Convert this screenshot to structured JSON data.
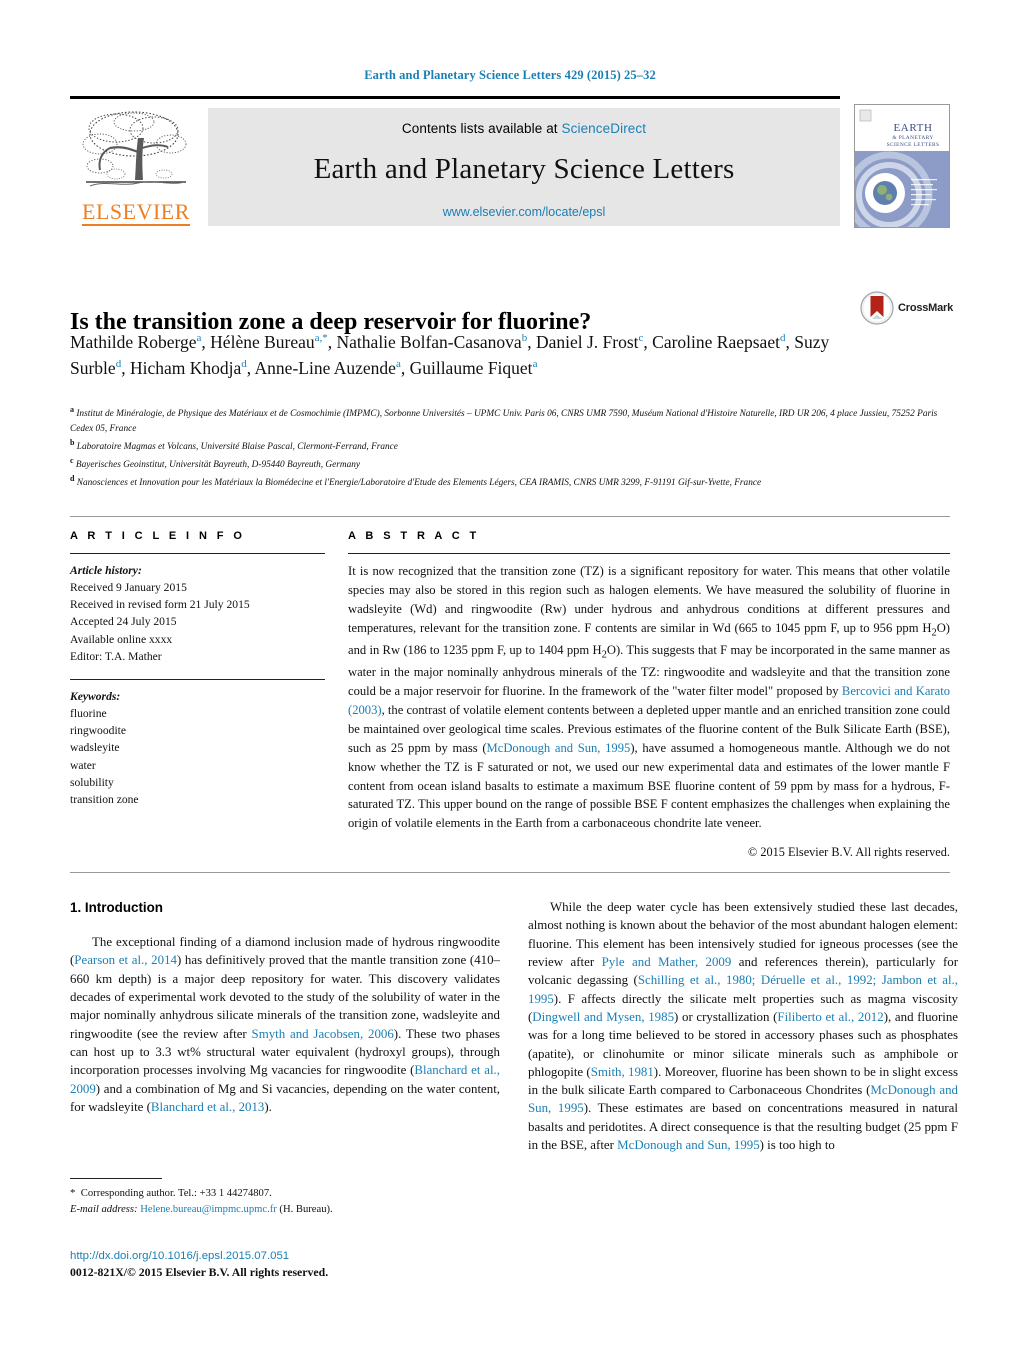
{
  "running_head": "Earth and Planetary Science Letters 429 (2015) 25–32",
  "masthead": {
    "contents_prefix": "Contents lists available at ",
    "sciencedirect": "ScienceDirect",
    "journal_title": "Earth and Planetary Science Letters",
    "journal_url": "www.elsevier.com/locate/epsl",
    "publisher": "ELSEVIER",
    "cover_title_line1": "EARTH",
    "cover_title_line2": "& PLANETARY",
    "cover_title_line3": "SCIENCE LETTERS"
  },
  "article": {
    "title": "Is the transition zone a deep reservoir for fluorine?",
    "crossmark_label": "CrossMark",
    "authors_html": "Mathilde Roberge<sup>a</sup>, Hélène Bureau<sup>a,*</sup>, Nathalie Bolfan-Casanova<sup>b</sup>, Daniel J. Frost<sup>c</sup>, Caroline Raepsaet<sup>d</sup>, Suzy Surble<sup>d</sup>, Hicham Khodja<sup>d</sup>, Anne-Line Auzende<sup>a</sup>, Guillaume Fiquet<sup>a</sup>",
    "affiliations": [
      {
        "label": "a",
        "text": "Institut de Minéralogie, de Physique des Matériaux et de Cosmochimie (IMPMC), Sorbonne Universités – UPMC Univ. Paris 06, CNRS UMR 7590, Muséum National d'Histoire Naturelle, IRD UR 206, 4 place Jussieu, 75252 Paris Cedex 05, France"
      },
      {
        "label": "b",
        "text": "Laboratoire Magmas et Volcans, Université Blaise Pascal, Clermont-Ferrand, France"
      },
      {
        "label": "c",
        "text": "Bayerisches Geoinstitut, Universität Bayreuth, D-95440 Bayreuth, Germany"
      },
      {
        "label": "d",
        "text": "Nanosciences et Innovation pour les Matériaux la Biomédecine et l'Energie/Laboratoire d'Etude des Elements Légers, CEA IRAMIS, CNRS UMR 3299, F-91191 Gif-sur-Yvette, France"
      }
    ]
  },
  "article_info": {
    "heading": "A R T I C L E   I N F O",
    "history_label": "Article history:",
    "history": [
      "Received 9 January 2015",
      "Received in revised form 21 July 2015",
      "Accepted 24 July 2015",
      "Available online xxxx",
      "Editor: T.A. Mather"
    ],
    "keywords_label": "Keywords:",
    "keywords": [
      "fluorine",
      "ringwoodite",
      "wadsleyite",
      "water",
      "solubility",
      "transition zone"
    ]
  },
  "abstract": {
    "heading": "A B S T R A C T",
    "paragraph_html": "It is now recognized that the transition zone (TZ) is a significant repository for water. This means that other volatile species may also be stored in this region such as halogen elements. We have measured the solubility of fluorine in wadsleyite (Wd) and ringwoodite (Rw) under hydrous and anhydrous conditions at different pressures and temperatures, relevant for the transition zone. F contents are similar in Wd (665 to 1045 ppm F, up to 956 ppm H<sub>2</sub>O) and in Rw (186 to 1235 ppm F, up to 1404 ppm H<sub>2</sub>O). This suggests that F may be incorporated in the same manner as water in the major nominally anhydrous minerals of the TZ: ringwoodite and wadsleyite and that the transition zone could be a major reservoir for fluorine. In the framework of the \"water filter model\" proposed by <span class=\"ref\">Bercovici and Karato (2003)</span>, the contrast of volatile element contents between a depleted upper mantle and an enriched transition zone could be maintained over geological time scales. Previous estimates of the fluorine content of the Bulk Silicate Earth (BSE), such as 25 ppm by mass (<span class=\"ref\">McDonough and Sun, 1995</span>), have assumed a homogeneous mantle. Although we do not know whether the TZ is F saturated or not, we used our new experimental data and estimates of the lower mantle F content from ocean island basalts to estimate a maximum BSE fluorine content of 59 ppm by mass for a hydrous, F-saturated TZ. This upper bound on the range of possible BSE F content emphasizes the challenges when explaining the origin of volatile elements in the Earth from a carbonaceous chondrite late veneer.",
    "copyright": "© 2015 Elsevier B.V. All rights reserved."
  },
  "body": {
    "section_heading": "1. Introduction",
    "left_paragraph_html": "The exceptional finding of a diamond inclusion made of hydrous ringwoodite (<span class=\"ref\">Pearson et al., 2014</span>) has definitively proved that the mantle transition zone (410–660 km depth) is a major deep repository for water. This discovery validates decades of experimental work devoted to the study of the solubility of water in the major nominally anhydrous silicate minerals of the transition zone, wadsleyite and ringwoodite (see the review after <span class=\"ref\">Smyth and Jacobsen, 2006</span>). These two phases can host up to 3.3 wt% structural water equivalent (hydroxyl groups), through incorporation processes involving Mg vacancies for ringwoodite (<span class=\"ref\">Blanchard et al., 2009</span>) and a combination of Mg and Si vacancies, depending on the water content, for wadsleyite (<span class=\"ref\">Blanchard et al., 2013</span>).",
    "right_paragraph_html": "While the deep water cycle has been extensively studied these last decades, almost nothing is known about the behavior of the most abundant halogen element: fluorine. This element has been intensively studied for igneous processes (see the review after <span class=\"ref\">Pyle and Mather, 2009</span> and references therein), particularly for volcanic degassing (<span class=\"ref\">Schilling et al., 1980; Déruelle et al., 1992; Jambon et al., 1995</span>). F affects directly the silicate melt properties such as magma viscosity (<span class=\"ref\">Dingwell and Mysen, 1985</span>) or crystallization (<span class=\"ref\">Filiberto et al., 2012</span>), and fluorine was for a long time believed to be stored in accessory phases such as phosphates (apatite), or clinohumite or minor silicate minerals such as amphibole or phlogopite (<span class=\"ref\">Smith, 1981</span>). Moreover, fluorine has been shown to be in slight excess in the bulk silicate Earth compared to Carbonaceous Chondrites (<span class=\"ref\">McDonough and Sun, 1995</span>). These estimates are based on concentrations measured in natural basalts and peridotites. A direct consequence is that the resulting budget (25 ppm F in the BSE, after <span class=\"ref\">McDonough and Sun, 1995</span>) is too high to"
  },
  "footnotes": {
    "corresponding_html": "<span class=\"star\">*</span>&nbsp;&nbsp;Corresponding author. Tel.: +33 1 44274807.",
    "email_html": "<span class=\"em\">E-mail address:</span> <a href=\"#\">Helene.bureau@impmc.upmc.fr</a> (H. Bureau).",
    "doi": "http://dx.doi.org/10.1016/j.epsl.2015.07.051",
    "issn_line": "0012-821X/© 2015 Elsevier B.V. All rights reserved."
  },
  "colors": {
    "link_blue": "#1a7fb5",
    "elsevier_orange": "#ED7F22",
    "band_grey": "#e6e6e6"
  }
}
